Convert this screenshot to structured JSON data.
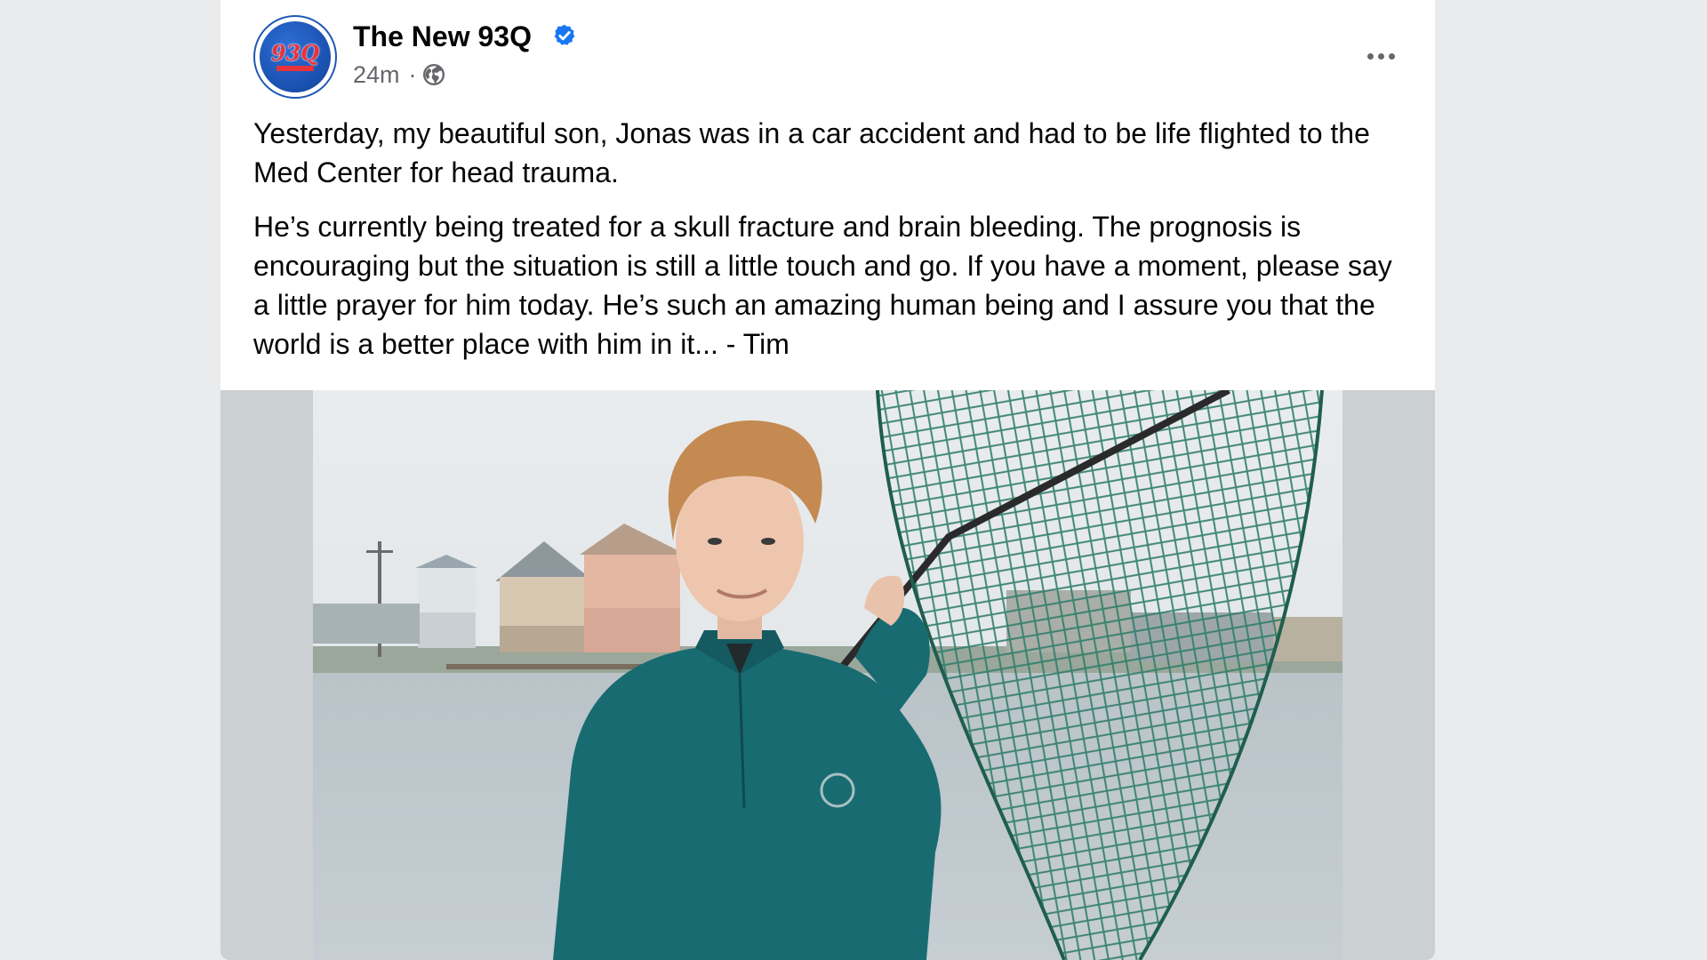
{
  "post": {
    "page_name": "The New 93Q",
    "verified": true,
    "timestamp": "24m",
    "separator": "·",
    "audience_icon": "globe-icon",
    "more_icon": "more-options-icon",
    "logo_text": "93Q",
    "paragraphs": [
      "Yesterday, my beautiful son, Jonas was in a car accident and had to be life flighted to the Med Center for head trauma.",
      "He’s currently being treated for a skull fracture and brain bleeding. The prognosis is encouraging but the situation is still a little touch and go. If you have a moment, please say a little prayer for him today. He’s such an amazing human being and I assure you that the world is a better place with him in it... - Tim"
    ]
  },
  "colors": {
    "background": "#eaebed",
    "card": "#ffffff",
    "verified_blue": "#1877f2",
    "secondary_text": "#65676b",
    "primary_text": "#050505"
  }
}
